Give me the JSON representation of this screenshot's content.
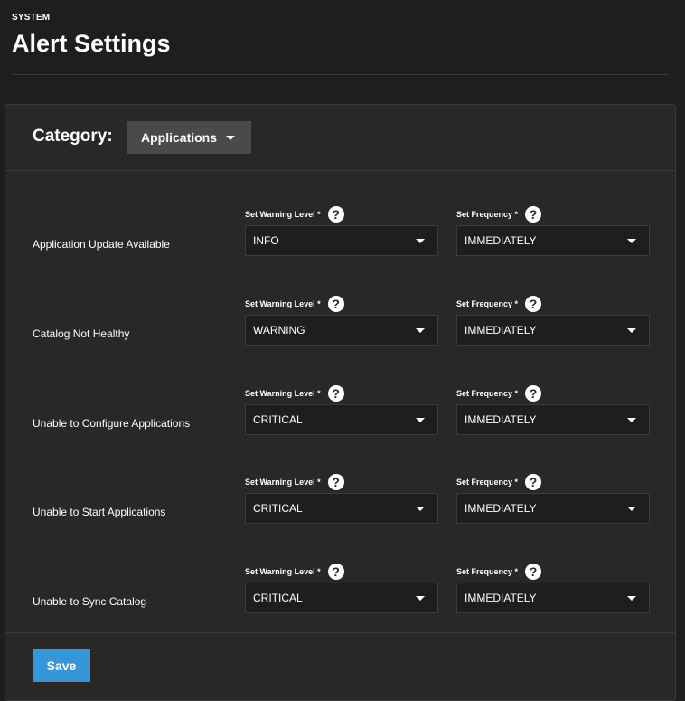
{
  "header": {
    "breadcrumb": "SYSTEM",
    "title": "Alert Settings"
  },
  "category": {
    "label": "Category:",
    "selected": "Applications"
  },
  "field_labels": {
    "warning": "Set Warning Level *",
    "frequency": "Set Frequency *"
  },
  "alerts": [
    {
      "name": "Application Update Available",
      "level": "INFO",
      "frequency": "IMMEDIATELY"
    },
    {
      "name": "Catalog Not Healthy",
      "level": "WARNING",
      "frequency": "IMMEDIATELY"
    },
    {
      "name": "Unable to Configure Applications",
      "level": "CRITICAL",
      "frequency": "IMMEDIATELY"
    },
    {
      "name": "Unable to Start Applications",
      "level": "CRITICAL",
      "frequency": "IMMEDIATELY"
    },
    {
      "name": "Unable to Sync Catalog",
      "level": "CRITICAL",
      "frequency": "IMMEDIATELY"
    }
  ],
  "actions": {
    "save_label": "Save"
  },
  "colors": {
    "background": "#1e1e1e",
    "card": "#282828",
    "primary": "#3596d8",
    "category_select": "#4a4a4a"
  },
  "icons": {
    "help": "help-circle-icon",
    "dropdown": "chevron-down-icon"
  }
}
